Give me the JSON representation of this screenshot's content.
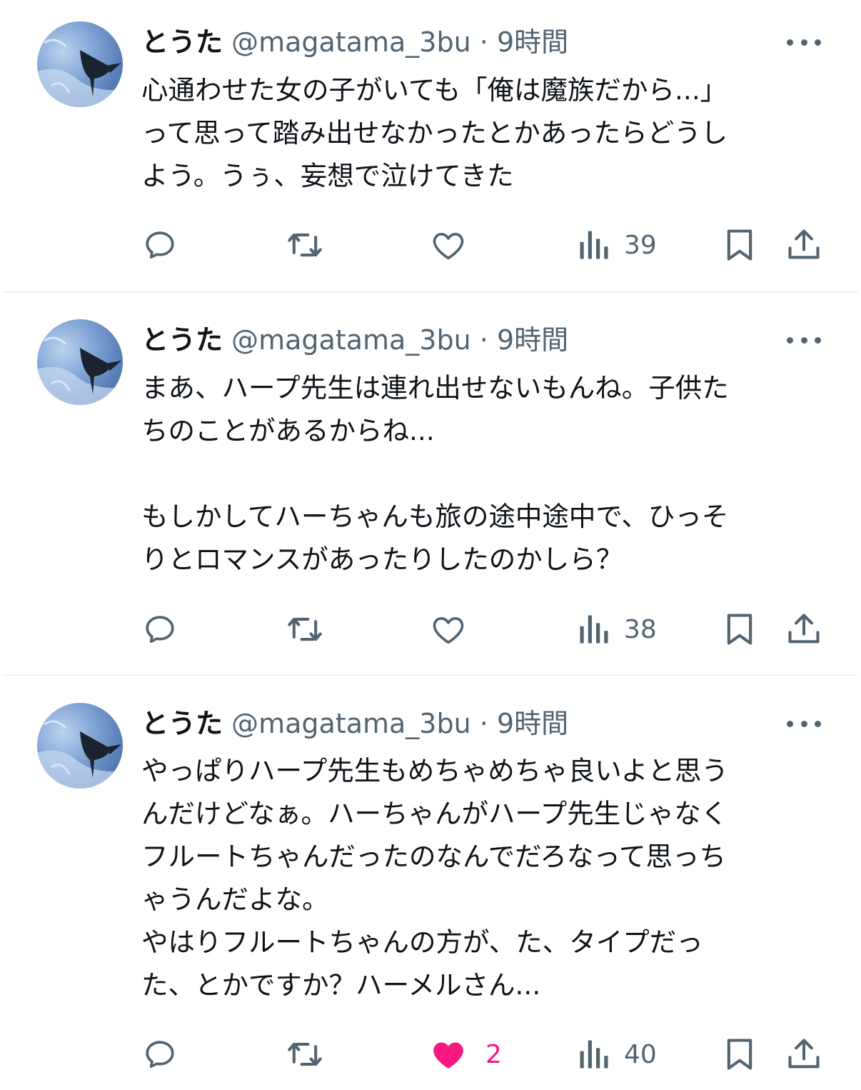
{
  "tweets": [
    {
      "name": "とうた",
      "handle": "@magatama_3bu",
      "sep": "·",
      "time": "9時間",
      "text": [
        "心通わせた女の子がいても「俺は魔族だから...」",
        "って思って踏み出せなかったとかあったらどうし",
        "よう。うぅ、妄想で泣けてきた"
      ],
      "views": "39",
      "likes": "",
      "liked": false
    },
    {
      "name": "とうた",
      "handle": "@magatama_3bu",
      "sep": "·",
      "time": "9時間",
      "text": [
        "まあ、ハープ先生は連れ出せないもんね。子供た",
        "ちのことがあるからね...",
        "",
        "もしかしてハーちゃんも旅の途中途中で、ひっそ",
        "りとロマンスがあったりしたのかしら？"
      ],
      "views": "38",
      "likes": "",
      "liked": false
    },
    {
      "name": "とうた",
      "handle": "@magatama_3bu",
      "sep": "·",
      "time": "9時間",
      "text": [
        "やっぱりハープ先生もめちゃめちゃ良いよと思う",
        "んだけどなぁ。ハーちゃんがハープ先生じゃなく",
        "フルートちゃんだったのなんでだろなって思っち",
        "ゃうんだよな。",
        "やはりフルートちゃんの方が、た、タイプだっ",
        "た、とかですか？ハーメルさん..."
      ],
      "views": "40",
      "likes": "2",
      "liked": true
    }
  ],
  "colors": {
    "text": "#0f1419",
    "secondary": "#536471",
    "like": "#f91880",
    "divider": "#eff3f4"
  },
  "icons": {
    "reply": "reply-icon",
    "retweet": "retweet-icon",
    "like": "heart-icon",
    "views": "views-icon",
    "bookmark": "bookmark-icon",
    "share": "share-icon",
    "more": "more-icon"
  }
}
